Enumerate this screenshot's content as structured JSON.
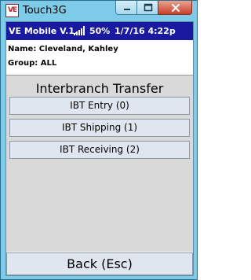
{
  "window": {
    "title": "Touch3G",
    "icon_text": "VE",
    "icon": "app-logo-icon",
    "controls": {
      "minimize": "minimize-icon",
      "maximize": "maximize-icon",
      "close": "close-icon"
    }
  },
  "status": {
    "app_version": "VE Mobile V.1.",
    "signal_icon": "signal-strength-icon",
    "battery": "50%",
    "datetime": "1/7/16 4:22p"
  },
  "user": {
    "name_label": "Name: Cleveland, Kahley",
    "group_label": "Group: ALL"
  },
  "panel": {
    "title": "Interbranch Transfer",
    "items": [
      {
        "label": "IBT Entry (0)"
      },
      {
        "label": "IBT Shipping (1)"
      },
      {
        "label": "IBT Receiving (2)"
      }
    ]
  },
  "footer": {
    "back_label": "Back (Esc)"
  },
  "colors": {
    "frame": "#7ecbe9",
    "status_bar": "#1a1aa0",
    "panel_bg": "#d9d9d9",
    "button_bg": "#dfe6ef",
    "close_button": "#c8402a"
  }
}
